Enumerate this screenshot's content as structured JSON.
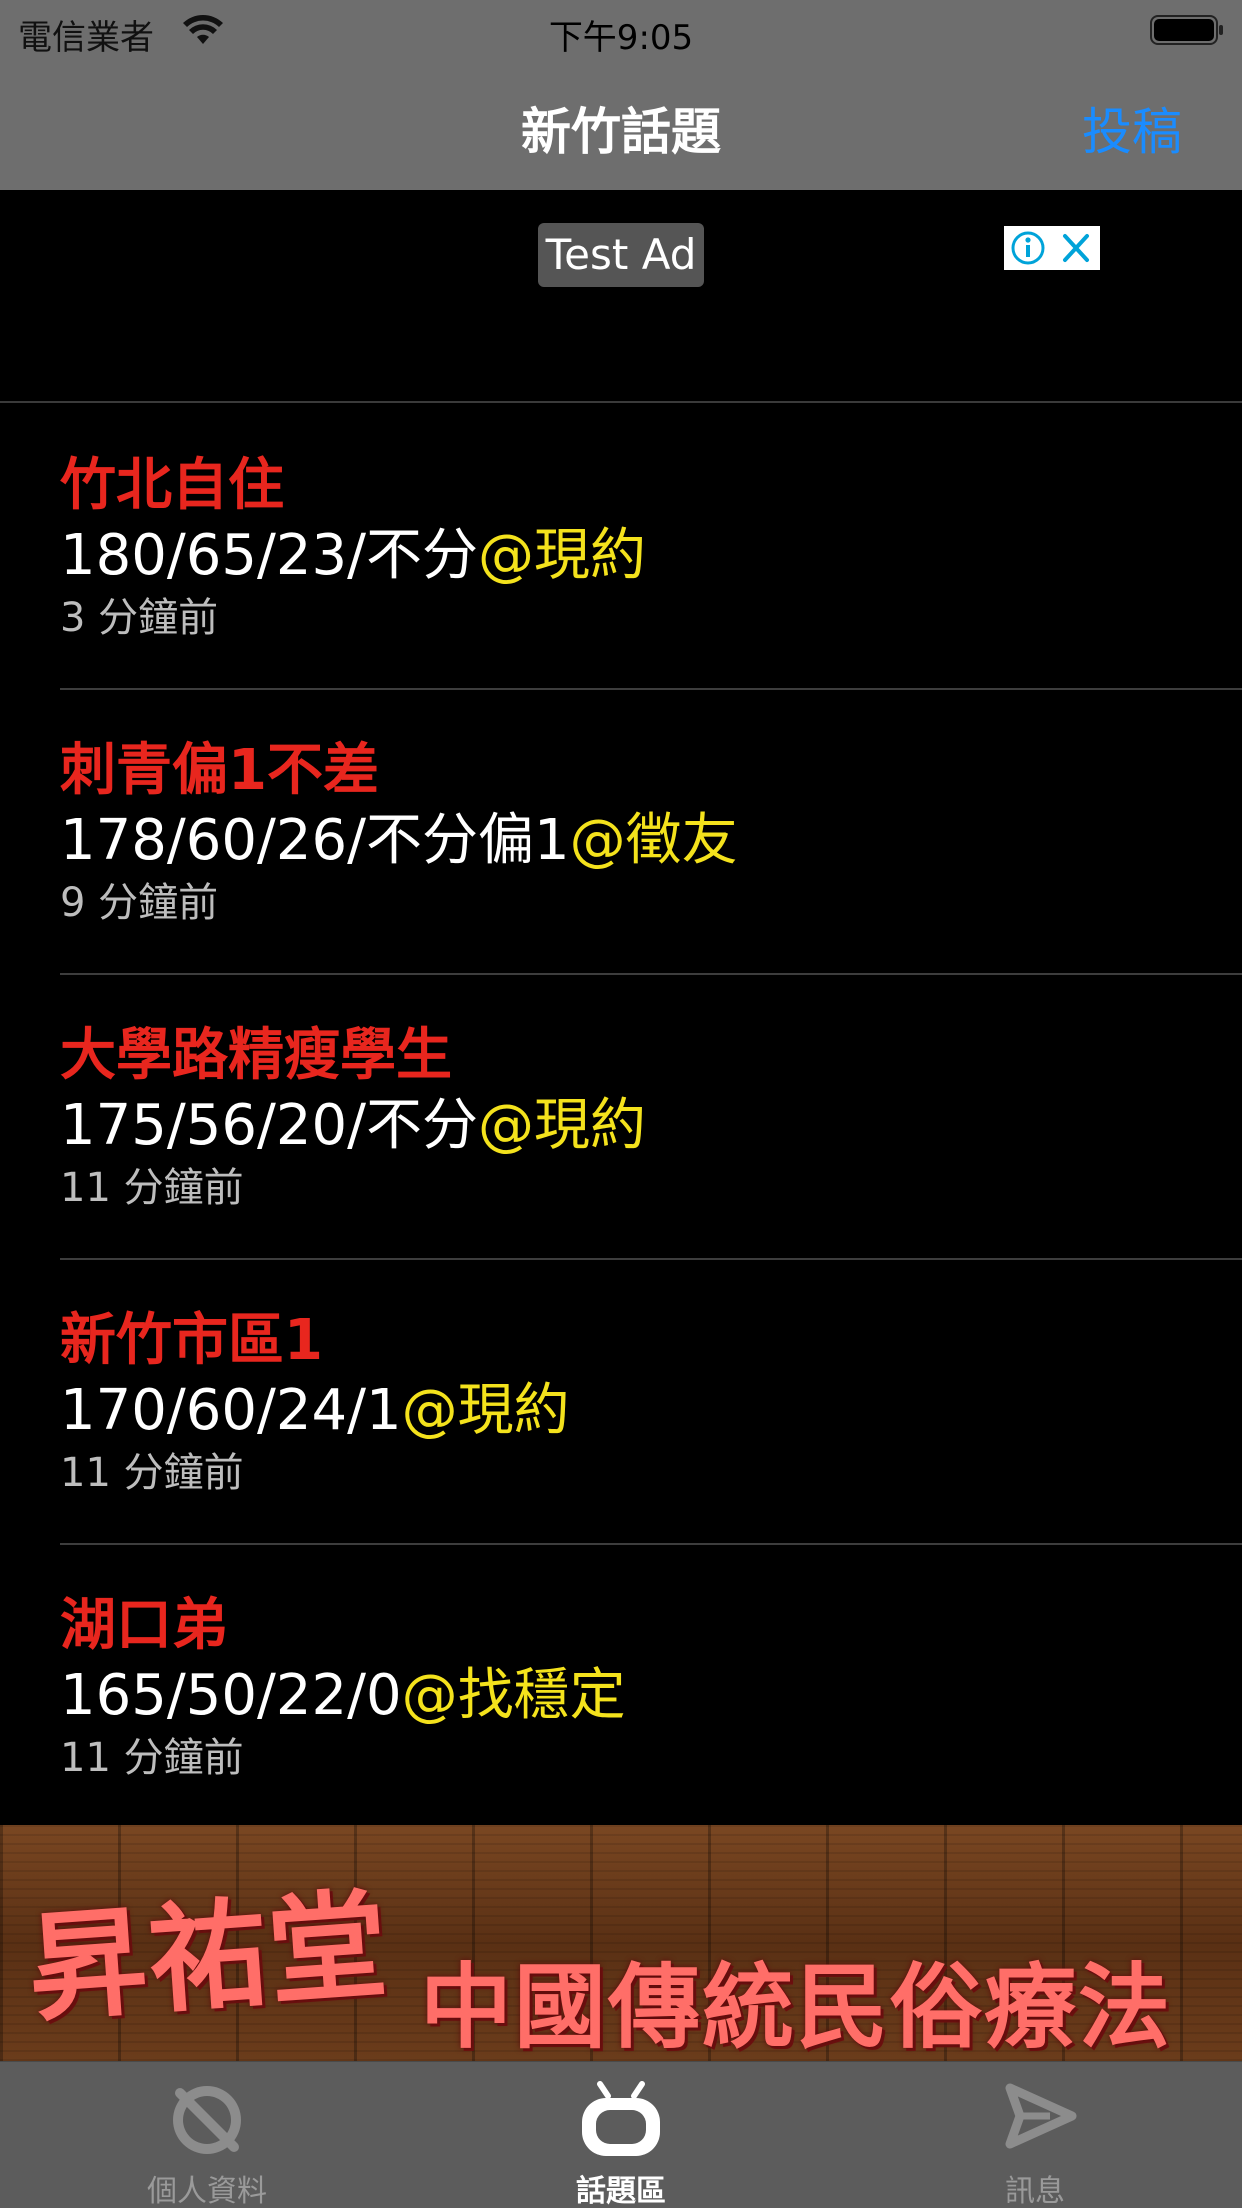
{
  "status_bar": {
    "carrier": "電信業者",
    "time": "下午9:05"
  },
  "nav": {
    "title": "新竹話題",
    "action_label": "投稿"
  },
  "ad": {
    "label": "Test Ad"
  },
  "topics": [
    {
      "title": "竹北自住",
      "stats": "180/65/23/不分",
      "tag": "@現約",
      "time": "3 分鐘前"
    },
    {
      "title": "刺青偏1不差",
      "stats": "178/60/26/不分偏1",
      "tag": "@徵友",
      "time": "9 分鐘前"
    },
    {
      "title": "大學路精瘦學生",
      "stats": "175/56/20/不分",
      "tag": "@現約",
      "time": "11 分鐘前"
    },
    {
      "title": "新竹市區1",
      "stats": "170/60/24/1",
      "tag": "@現約",
      "time": "11 分鐘前"
    },
    {
      "title": "湖口弟",
      "stats": "165/50/22/0",
      "tag": "@找穩定",
      "time": "11 分鐘前"
    }
  ],
  "banner": {
    "shop_name": "昇祐堂",
    "slogan": "中國傳統民俗療法"
  },
  "tabs": [
    {
      "label": "個人資料",
      "icon": "profile-icon",
      "active": false
    },
    {
      "label": "話題區",
      "icon": "topics-tv-icon",
      "active": true
    },
    {
      "label": "訊息",
      "icon": "message-send-icon",
      "active": false
    }
  ],
  "colors": {
    "title_red": "#e8261e",
    "tag_yellow": "#f4e21c",
    "link_blue": "#1a8cff",
    "bar_gray": "#6e6e6e",
    "tab_gray": "#5c5c5c"
  }
}
